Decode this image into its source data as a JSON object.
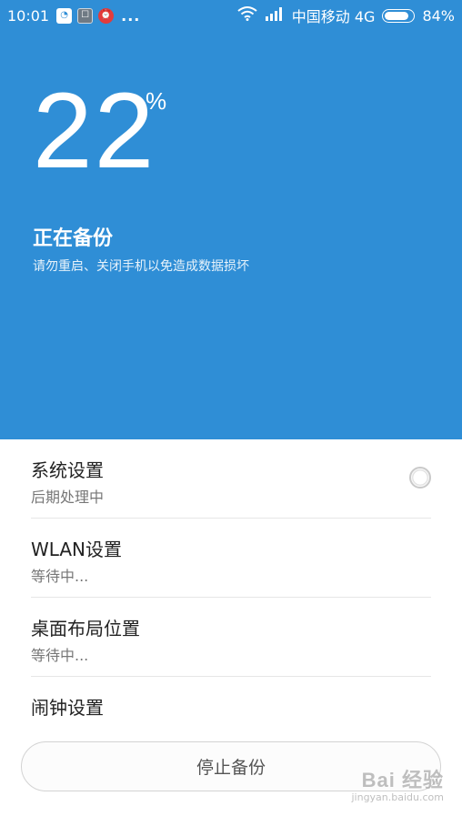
{
  "status_bar": {
    "time": "10:01",
    "more": "...",
    "carrier": "中国移动 4G",
    "battery_pct": "84%",
    "battery_level": 0.84,
    "icons": [
      "app-notification-icon",
      "app-gray-icon",
      "alarm-app-icon",
      "wifi-icon",
      "signal-icon",
      "battery-icon"
    ]
  },
  "progress": {
    "value": "22",
    "unit": "%"
  },
  "status": {
    "title": "正在备份",
    "subtitle": "请勿重启、关闭手机以免造成数据损坏"
  },
  "items": [
    {
      "name": "系统设置",
      "state": "后期处理中"
    },
    {
      "name": "WLAN设置",
      "state": "等待中..."
    },
    {
      "name": "桌面布局位置",
      "state": "等待中..."
    },
    {
      "name": "闹钟设置",
      "state": ""
    }
  ],
  "stop_button": {
    "label": "停止备份"
  },
  "watermark": {
    "main": "Bai 经验",
    "sub": "jingyan.baidu.com"
  },
  "colors": {
    "header_bg": "#2f8ed6",
    "text_dark": "#222222",
    "text_muted": "#777777"
  }
}
